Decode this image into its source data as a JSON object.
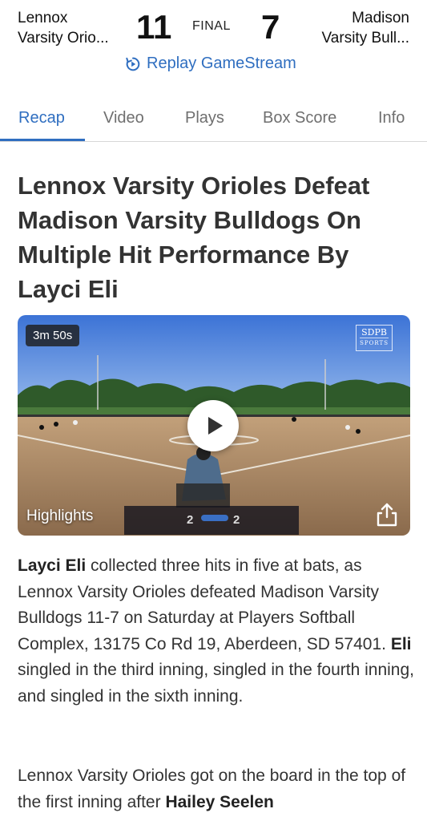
{
  "game": {
    "home_team": "Lennox\nVarsity Orio...",
    "home_team_line1": "Lennox",
    "home_team_line2": "Varsity Orio...",
    "home_score": "11",
    "status": "FINAL",
    "away_score": "7",
    "away_team_line1": "Madison",
    "away_team_line2": "Varsity Bull...",
    "replay_label": "Replay GameStream"
  },
  "tabs": [
    {
      "label": "Recap",
      "active": true
    },
    {
      "label": "Video",
      "active": false
    },
    {
      "label": "Plays",
      "active": false
    },
    {
      "label": "Box Score",
      "active": false
    },
    {
      "label": "Info",
      "active": false
    }
  ],
  "article": {
    "headline": "Lennox Varsity Orioles Defeat Madison Varsity Bulldogs On Multiple Hit Performance By Layci Eli",
    "video": {
      "duration": "3m 50s",
      "brand_top": "SDPB",
      "brand_bottom": "SPORTS",
      "label": "Highlights",
      "overlay_score_left": "2",
      "overlay_score_right": "2"
    },
    "p1_name": "Layci Eli",
    "p1_text_a": " collected three hits in five at bats, as Lennox Varsity Orioles defeated Madison Varsity Bulldogs 11-7 on Saturday at Players Softball Complex, 13175 Co Rd 19, Aberdeen, SD 57401. ",
    "p1_name2": "Eli",
    "p1_text_b": " singled in the third inning, singled in the fourth inning, and singled in the sixth inning.",
    "p2_text_a": "Lennox Varsity Orioles got on the board in the top of the first inning after ",
    "p2_name": "Hailey Seelen"
  },
  "colors": {
    "accent": "#2f6ec0",
    "tab_inactive": "#6f6f6f",
    "text": "#333333"
  }
}
